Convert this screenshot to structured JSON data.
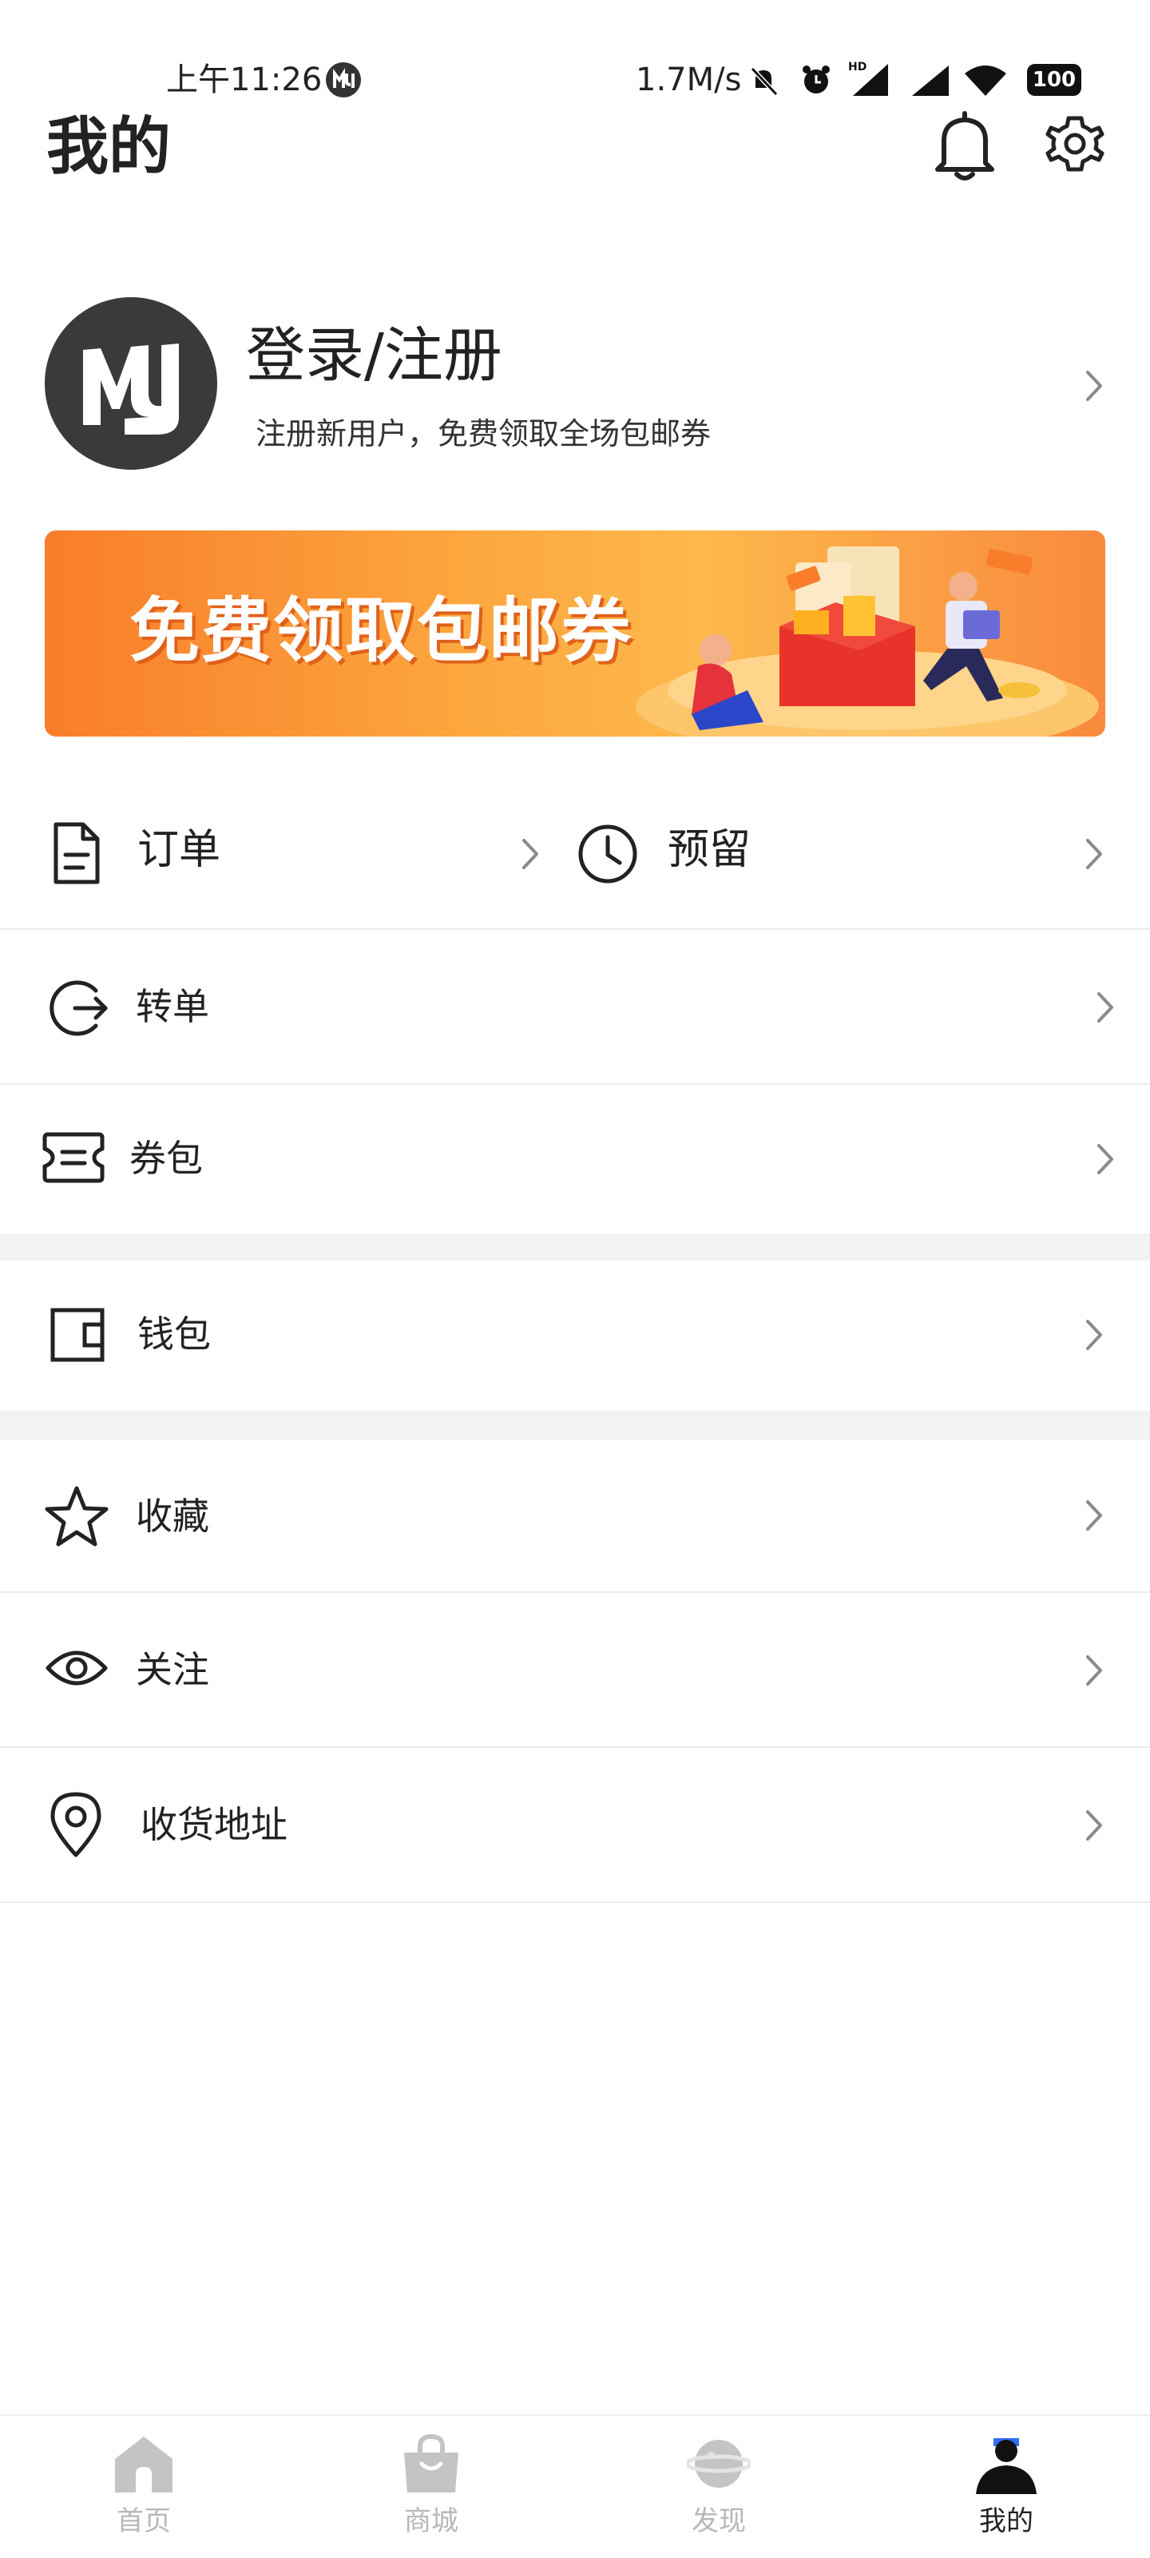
{
  "status_bar": {
    "time": "上午11:26",
    "network_speed": "1.7M/s",
    "battery": "100"
  },
  "header": {
    "title": "我的",
    "icons": [
      "bell-icon",
      "gear-icon"
    ]
  },
  "profile": {
    "login_label": "登录/注册",
    "subtitle": "注册新用户，免费领取全场包邮券"
  },
  "banner": {
    "text": "免费领取包邮券"
  },
  "menu": {
    "orders": "订单",
    "reserve": "预留",
    "transfer": "转单",
    "coupons": "券包",
    "wallet": "钱包",
    "favorites": "收藏",
    "following": "关注",
    "address": "收货地址"
  },
  "tabbar": {
    "items": [
      {
        "label": "首页",
        "icon": "home-icon",
        "active": false
      },
      {
        "label": "商城",
        "icon": "shopping-bag-icon",
        "active": false
      },
      {
        "label": "发现",
        "icon": "planet-icon",
        "active": false
      },
      {
        "label": "我的",
        "icon": "user-icon",
        "active": true
      }
    ]
  },
  "colors": {
    "text": "#222222",
    "tab_inactive": "#b8b8b8",
    "tab_active_accent": "#2f6df6",
    "banner_orange": "#f97d2b",
    "divider": "#ececec",
    "gap": "#f2f2f2"
  }
}
